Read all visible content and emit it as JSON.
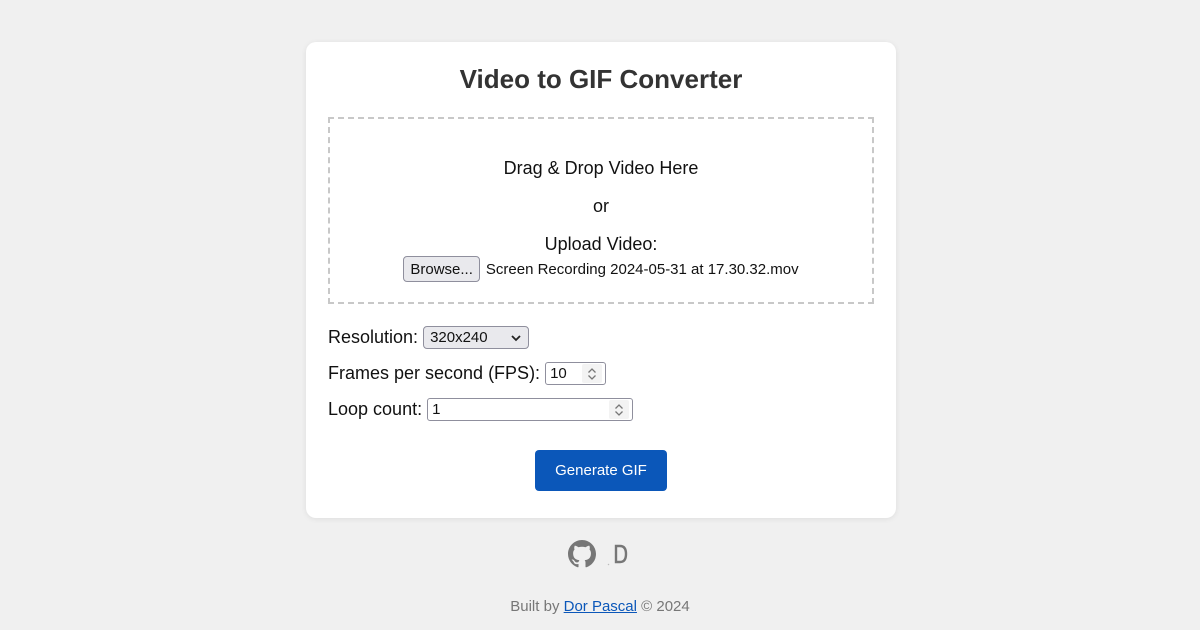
{
  "app": {
    "title": "Video to GIF Converter"
  },
  "dropzone": {
    "drag_text": "Drag & Drop Video Here",
    "or_text": "or",
    "upload_label": "Upload Video:",
    "browse_label": "Browse...",
    "file_name": "Screen Recording 2024-05-31 at 17.30.32.mov"
  },
  "settings": {
    "resolution_label": "Resolution:",
    "resolution_value": "320x240",
    "fps_label": "Frames per second (FPS):",
    "fps_value": "10",
    "loop_label": "Loop count:",
    "loop_value": "1"
  },
  "actions": {
    "generate_label": "Generate GIF"
  },
  "footer": {
    "built_by": "Built by",
    "author": "Dor Pascal",
    "copyright": "© 2024",
    "icons": [
      "github-icon",
      "dev-icon"
    ]
  },
  "colors": {
    "background": "#f0f0f0",
    "primary_button": "#0b57b9",
    "link": "#0b57b9"
  }
}
